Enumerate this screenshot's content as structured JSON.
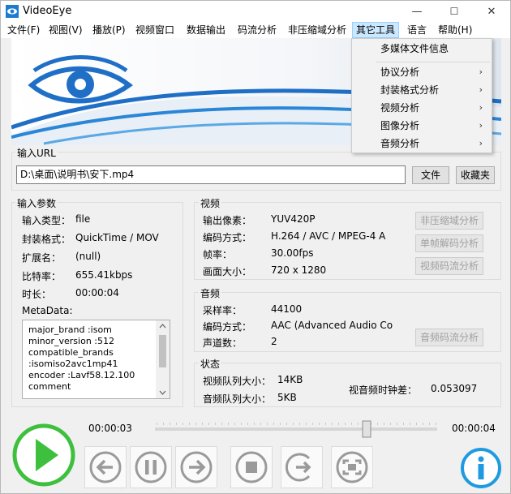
{
  "window": {
    "title": "VideoEye",
    "minimize": "—",
    "maximize": "☐",
    "close": "✕"
  },
  "menu": [
    "文件(F)",
    "视图(V)",
    "播放(P)",
    "视频窗口",
    "数据输出",
    "码流分析",
    "非压缩域分析",
    "其它工具",
    "语言",
    "帮助(H)"
  ],
  "dropdown": {
    "items": [
      {
        "label": "多媒体文件信息",
        "arrow": ""
      },
      {
        "label": "协议分析",
        "arrow": "›"
      },
      {
        "label": "封装格式分析",
        "arrow": "›"
      },
      {
        "label": "视频分析",
        "arrow": "›"
      },
      {
        "label": "图像分析",
        "arrow": "›"
      },
      {
        "label": "音频分析",
        "arrow": "›"
      }
    ]
  },
  "url": {
    "group_label": "输入URL",
    "value": "D:\\桌面\\说明书\\安下.mp4",
    "file_button": "文件",
    "favorites_button": "收藏夹"
  },
  "params": {
    "group_label": "输入参数",
    "rows": [
      {
        "label": "输入类型：",
        "value": "file"
      },
      {
        "label": "封装格式：",
        "value": "QuickTime / MOV"
      },
      {
        "label": "扩展名：",
        "value": "(null)"
      },
      {
        "label": "比特率：",
        "value": "655.41kbps"
      },
      {
        "label": "时长：",
        "value": "00:00:04"
      }
    ],
    "metadata_label": "MetaData:",
    "metadata_lines": [
      "major_brand       :isom",
      "minor_version     :512",
      "compatible_brands",
      ":isomiso2avc1mp41",
      "encoder   :Lavf58.12.100",
      "comment"
    ]
  },
  "video": {
    "group_label": "视频",
    "rows": [
      {
        "label": "输出像素：",
        "value": "YUV420P"
      },
      {
        "label": "编码方式：",
        "value": "H.264 / AVC / MPEG-4 A"
      },
      {
        "label": "帧率：",
        "value": "30.00fps"
      },
      {
        "label": "画面大小：",
        "value": "720 x 1280"
      }
    ],
    "buttons": [
      "非压缩域分析",
      "单帧解码分析",
      "视频码流分析"
    ]
  },
  "audio": {
    "group_label": "音频",
    "rows": [
      {
        "label": "采样率：",
        "value": "44100"
      },
      {
        "label": "编码方式：",
        "value": "AAC (Advanced Audio Co"
      },
      {
        "label": "声道数：",
        "value": "2"
      }
    ],
    "button": "音频码流分析"
  },
  "status": {
    "group_label": "状态",
    "video_queue_label": "视频队列大小：",
    "video_queue_value": "14KB",
    "audio_queue_label": "音频队列大小：",
    "audio_queue_value": "5KB",
    "av_diff_label": "视音频时钟差：",
    "av_diff_value": "0.053097"
  },
  "playback": {
    "current_time": "00:00:03",
    "total_time": "00:00:04",
    "progress": 0.75
  },
  "colors": {
    "accent_green": "#3ec03e",
    "control_gray": "#9a9a9a",
    "info_blue": "#1e9be0",
    "menu_highlight": "#cce8ff"
  },
  "icons": {
    "app": "eye-logo-icon",
    "play": "play-icon",
    "previous": "arrow-left-icon",
    "pause": "pause-icon",
    "next": "arrow-right-icon",
    "stop": "stop-icon",
    "step": "step-frame-icon",
    "fullscreen": "fullscreen-icon",
    "info": "info-icon"
  }
}
